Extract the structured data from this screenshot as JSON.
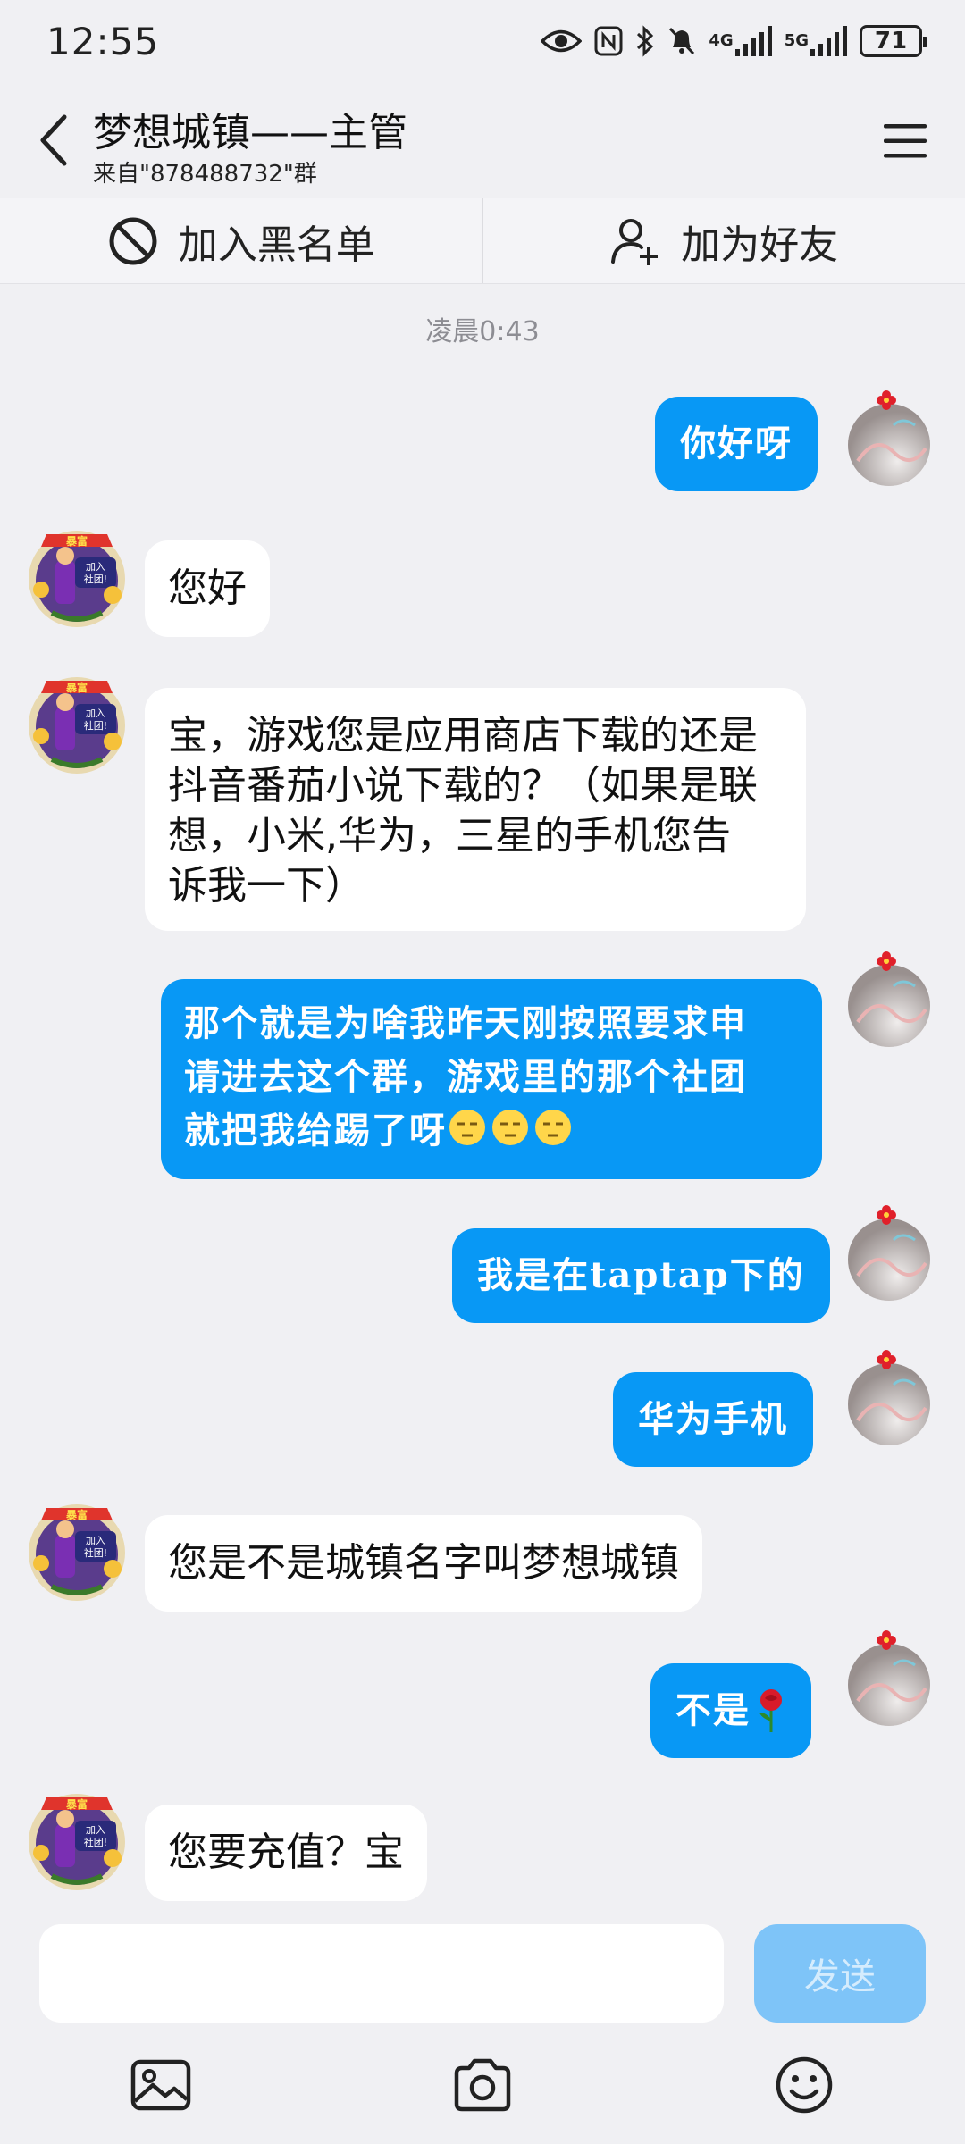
{
  "status_bar": {
    "time": "12:55",
    "network_1": "4G",
    "network_2": "5G",
    "battery": "71"
  },
  "header": {
    "title": "梦想城镇——主管",
    "subtitle": "来自\"878488732\"群"
  },
  "actions": {
    "blacklist_label": "加入黑名单",
    "add_friend_label": "加为好友"
  },
  "chat": {
    "timestamp": "凌晨0:43",
    "messages": [
      {
        "sender": "self",
        "text": "你好呀"
      },
      {
        "sender": "other",
        "text": "您好"
      },
      {
        "sender": "other",
        "lines": [
          "宝，游戏您是应用商店下载的还是",
          "抖音番茄小说下载的？（如果是联",
          "想，小米,华为，三星的手机您告",
          "诉我一下）"
        ]
      },
      {
        "sender": "self",
        "lines": [
          "那个就是为啥我昨天刚按照要求申",
          "请进去这个群，游戏里的那个社团",
          "就把我给踢了呀"
        ],
        "emoji": "unamused-face"
      },
      {
        "sender": "self",
        "text": "我是在taptap下的"
      },
      {
        "sender": "self",
        "text": "华为手机"
      },
      {
        "sender": "other",
        "text": "您是不是城镇名字叫梦想城镇"
      },
      {
        "sender": "self",
        "text": "不是",
        "emoji": "rose"
      },
      {
        "sender": "other",
        "text": "您要充值？宝"
      }
    ]
  },
  "avatar_other_badge": {
    "top": "暴富",
    "line1": "加入",
    "line2": "社团!"
  },
  "composer": {
    "placeholder": "",
    "send_label": "发送"
  },
  "colors": {
    "self_bubble": "#0898f5",
    "other_bubble": "#ffffff",
    "send_button": "#7ec4f8",
    "background": "#f0f0f3"
  }
}
